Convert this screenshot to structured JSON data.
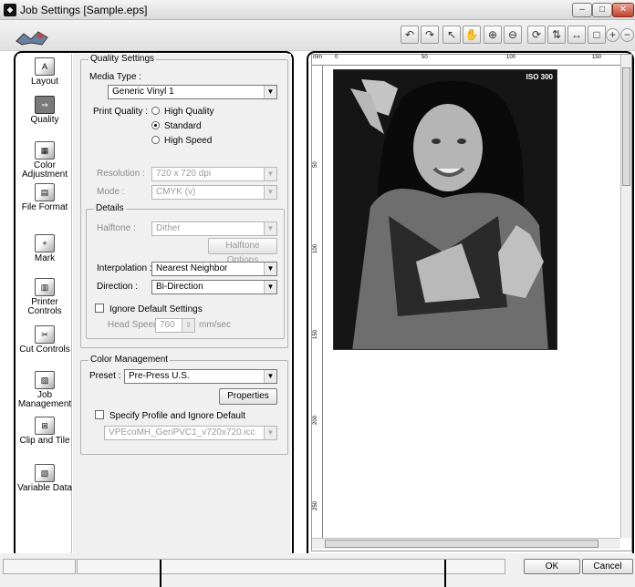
{
  "window": {
    "title": "Job Settings [Sample.eps]",
    "minimize": "–",
    "maximize": "□",
    "close": "✕"
  },
  "toolbar": {
    "icons": [
      "undo-icon",
      "redo-icon",
      "pointer-icon",
      "hand-icon",
      "zoom-in-icon",
      "zoom-out-icon",
      "rotate-icon",
      "flip-icon",
      "fit-width-icon",
      "fit-page-icon",
      "zoom-plus-icon",
      "zoom-minus-icon"
    ],
    "glyphs": [
      "↶",
      "↷",
      "↖",
      "✋",
      "⊕",
      "⊖",
      "⟳",
      "⇅",
      "↔",
      "□",
      "+",
      "−"
    ]
  },
  "nav": {
    "items": [
      {
        "id": "layout",
        "label": "Layout",
        "glyph": "A",
        "selected": false
      },
      {
        "id": "quality",
        "label": "Quality",
        "glyph": "⇒",
        "selected": true
      },
      {
        "id": "color",
        "label": "Color Adjustment",
        "glyph": "▦",
        "selected": false
      },
      {
        "id": "fileformat",
        "label": "File Format",
        "glyph": "▤",
        "selected": false
      },
      {
        "id": "mark",
        "label": "Mark",
        "glyph": "+",
        "selected": false
      },
      {
        "id": "printer",
        "label": "Printer Controls",
        "glyph": "▥",
        "selected": false
      },
      {
        "id": "cut",
        "label": "Cut Controls",
        "glyph": "✂",
        "selected": false
      },
      {
        "id": "job",
        "label": "Job Management",
        "glyph": "▨",
        "selected": false
      },
      {
        "id": "clip",
        "label": "Clip and Tile",
        "glyph": "⊞",
        "selected": false
      },
      {
        "id": "variable",
        "label": "Variable Data",
        "glyph": "▧",
        "selected": false
      }
    ]
  },
  "quality": {
    "group_title": "Quality Settings",
    "media_type_label": "Media Type :",
    "media_type_value": "Generic Vinyl 1",
    "print_quality_label": "Print Quality :",
    "print_quality_options": [
      "High Quality",
      "Standard",
      "High Speed"
    ],
    "print_quality_selected": "Standard",
    "resolution_label": "Resolution :",
    "resolution_value": "720 x 720 dpi",
    "mode_label": "Mode :",
    "mode_value": "CMYK (v)"
  },
  "details": {
    "group_title": "Details",
    "halftone_label": "Halftone :",
    "halftone_value": "Dither",
    "halftone_options_button": "Halftone Options",
    "interpolation_label": "Interpolation :",
    "interpolation_value": "Nearest Neighbor",
    "direction_label": "Direction :",
    "direction_value": "Bi-Direction",
    "ignore_default_label": "Ignore Default Settings",
    "head_speed_label": "Head Speed",
    "head_speed_value": "760",
    "head_speed_unit": "mm/sec"
  },
  "color_management": {
    "group_title": "Color Management",
    "preset_label": "Preset :",
    "preset_value": "Pre-Press U.S.",
    "properties_button": "Properties",
    "specify_profile_label": "Specify Profile and Ignore Default",
    "profile_value": "VPEcoMH_GenPVC1_v720x720.icc"
  },
  "preview": {
    "ruler_unit": "mm",
    "ruler_top_ticks": [
      "0",
      "50",
      "100",
      "150"
    ],
    "ruler_left_ticks": [
      "50",
      "100",
      "150",
      "200",
      "250"
    ],
    "image_label": "ISO 300"
  },
  "footer": {
    "ok_label": "OK",
    "cancel_label": "Cancel"
  }
}
